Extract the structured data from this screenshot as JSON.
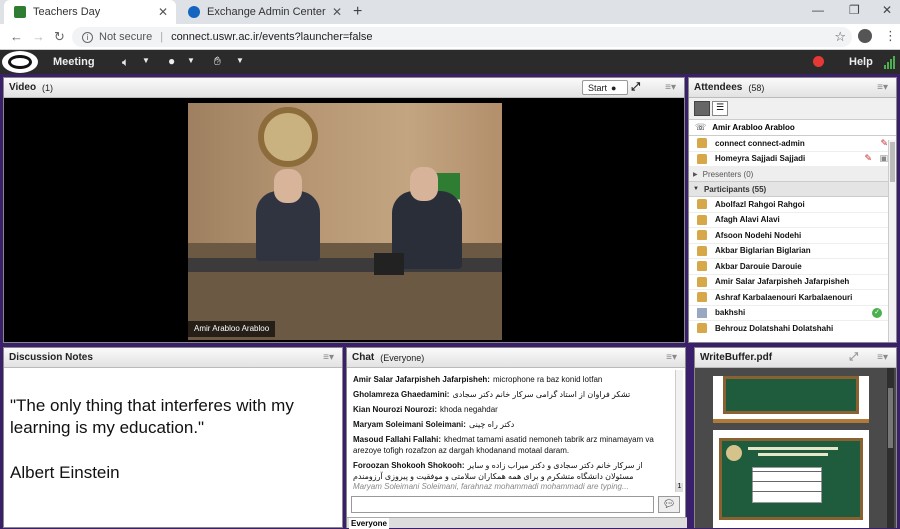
{
  "browser": {
    "tabs": [
      {
        "title": "Teachers Day",
        "active": true
      },
      {
        "title": "Exchange Admin Center",
        "active": false
      }
    ],
    "security": "Not secure",
    "url": "connect.uswr.ac.ir/events?launcher=false"
  },
  "appbar": {
    "meeting_label": "Meeting",
    "help_label": "Help"
  },
  "video": {
    "title": "Video",
    "count": "(1)",
    "start_label": "Start",
    "caption": "Amir Arabloo Arabloo"
  },
  "attendees": {
    "title": "Attendees",
    "count": "(58)",
    "host": "Amir Arabloo Arabloo",
    "hosts": [
      "connect connect-admin",
      "Homeyra Sajjadi Sajjadi"
    ],
    "presenters_label": "Presenters (0)",
    "participants_label": "Participants (55)",
    "participants": [
      "Abolfazl Rahgoi Rahgoi",
      "Afagh Alavi Alavi",
      "Afsoon Nodehi Nodehi",
      "Akbar Biglarian Biglarian",
      "Akbar Darouie Darouie",
      "Amir Salar Jafarpisheh Jafarpisheh",
      "Ashraf Karbalaenouri Karbalaenouri",
      "bakhshi",
      "Behrouz Dolatshahi Dolatshahi"
    ]
  },
  "notes": {
    "title": "Discussion Notes",
    "quote": "\"The only thing that interferes with my learning is my education.\"",
    "author": "Albert Einstein"
  },
  "chat": {
    "title": "Chat",
    "audience": "(Everyone)",
    "messages": [
      {
        "name": "Amir Salar Jafarpisheh Jafarpisheh:",
        "text": "microphone ra baz konid lotfan"
      },
      {
        "name": "Gholamreza Ghaedamini:",
        "text": "تشکر فراوان از استاد گرامی سرکار خانم دکتر سجادی"
      },
      {
        "name": "Kian Nourozi Nourozi:",
        "text": "khoda negahdar"
      },
      {
        "name": "Maryam Soleimani Soleimani:",
        "text": "دکتر راه چینی"
      },
      {
        "name": "Masoud Fallahi Fallahi:",
        "text": "khedmat tamami asatid nemoneh tabrik arz minamayam va arezoye tofigh rozafzon az dargah khodanand motaal daram."
      },
      {
        "name": "Foroozan Shokooh Shokooh:",
        "text": "از سرکار خانم دکتر سجادی و دکتر میراب زاده و سایر مسئولان دانشگاه متشکرم و برای همه همکاران سلامتی و موفقیت و پیروزی آرزومندم"
      }
    ],
    "typing": "Maryam Soleimani Soleimani, farahnaz mohammadi mohammadi are typing...",
    "badge": "1",
    "tab_everyone": "Everyone"
  },
  "pdf": {
    "title": "WriteBuffer.pdf"
  },
  "colors": {
    "frame": "#3a1f6a",
    "appbar": "#2b2b2b",
    "board": "#1f5c3e",
    "accent_green": "#4caf50"
  }
}
